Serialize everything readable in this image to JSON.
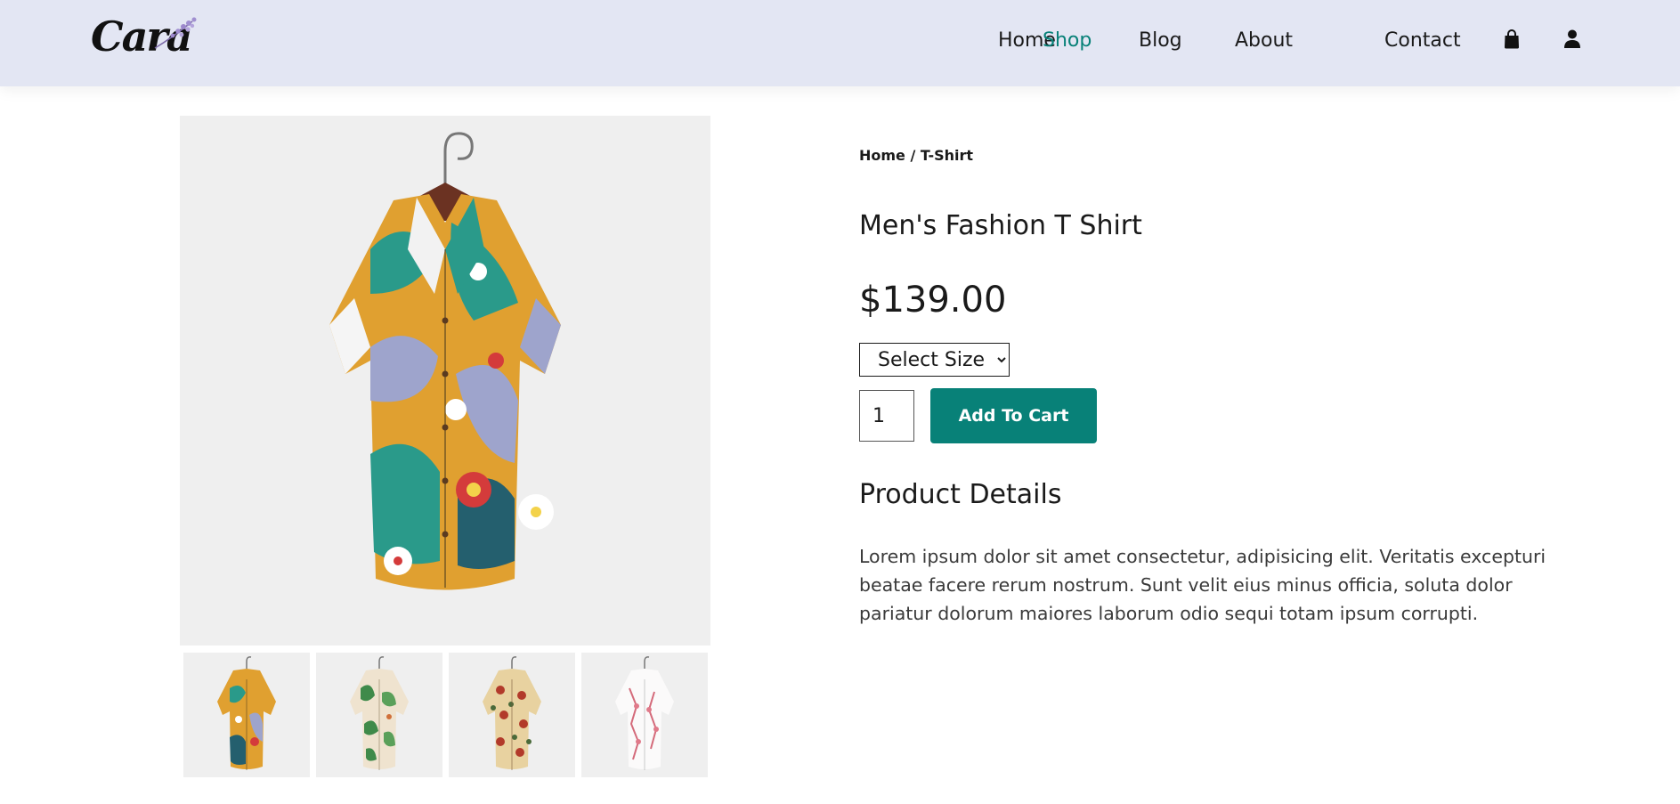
{
  "header": {
    "logo_text": "Cara",
    "nav": [
      {
        "label": "Home",
        "active": false
      },
      {
        "label": "Shop",
        "active": true
      },
      {
        "label": "Blog",
        "active": false
      },
      {
        "label": "About",
        "active": false
      },
      {
        "label": "Contact",
        "active": false
      }
    ],
    "icons": [
      "shopping-bag-icon",
      "user-icon"
    ]
  },
  "product": {
    "breadcrumb": "Home / T-Shirt",
    "title": "Men's Fashion T Shirt",
    "price": "$139.00",
    "size_select": {
      "selected": "Select Size"
    },
    "quantity": "1",
    "add_to_cart_label": "Add To Cart",
    "details_heading": "Product Details",
    "description": "Lorem ipsum dolor sit amet consectetur, adipisicing elit. Veritatis excepturi beatae facere rerum nostrum. Sunt velit eius minus officia, soluta dolor pariatur dolorum maiores laborum odio sequi totam ipsum corrupti."
  },
  "gallery": {
    "main_image": "patterned-shirt-teal-yellow",
    "thumbnails": [
      "patterned-shirt-teal-yellow",
      "leaf-print-shirt-beige",
      "floral-print-shirt-red",
      "floral-print-shirt-white"
    ]
  },
  "colors": {
    "accent": "#088178",
    "header_bg": "#e3e6f3",
    "image_bg": "#efefef"
  }
}
